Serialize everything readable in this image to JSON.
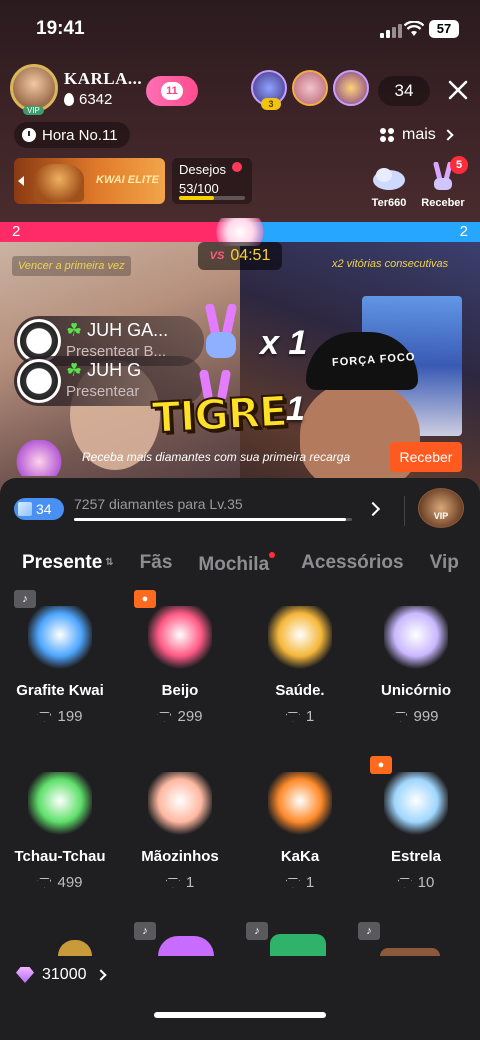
{
  "status_bar": {
    "time": "19:41",
    "battery": "57"
  },
  "host": {
    "name": "KARLA...",
    "fans": "6342",
    "vip_label": "VIP",
    "follow_count": "11"
  },
  "viewers": {
    "rank_badge": "3",
    "count": "34"
  },
  "hour": {
    "label": "Hora No.11"
  },
  "more": {
    "label": "mais"
  },
  "elite_banner": {
    "label": "KWAI ELITE"
  },
  "desejos": {
    "title": "Desejos",
    "value": "53/100",
    "progress": 0.53
  },
  "mini_gifts": [
    {
      "label": "Ter660"
    },
    {
      "label": "Receber",
      "badge": "5"
    }
  ],
  "pk": {
    "left_score": "2",
    "right_score": "2",
    "vs": "VS",
    "timer": "04:51",
    "left_label": "Vencer a primeira vez",
    "right_label": "x2 vitórias consecutivas"
  },
  "toasts": [
    {
      "name": "JUH GA...",
      "sub": "Presentear B...",
      "combo": "x 1"
    },
    {
      "name": "JUH G",
      "sub": "Presentear",
      "combo": "1"
    }
  ],
  "tigre": "TIGRE",
  "recharge": {
    "text": "Receba mais diamantes com sua primeira recarga",
    "button": "Receber"
  },
  "level": {
    "badge": "34",
    "text": "7257 diamantes para Lv.35",
    "progress": 0.98,
    "vip_label": "VIP"
  },
  "tabs": [
    "Presente",
    "Fãs",
    "Mochila",
    "Acessórios",
    "Vip"
  ],
  "gifts": [
    {
      "name": "Grafite Kwai",
      "price": "199",
      "tag": "music",
      "color": "#4fa6ff"
    },
    {
      "name": "Beijo",
      "price": "299",
      "tag": "orange",
      "color": "#ff5a86"
    },
    {
      "name": "Saúde.",
      "price": "1",
      "tag": "",
      "color": "#f5b73a"
    },
    {
      "name": "Unicórnio",
      "price": "999",
      "tag": "",
      "color": "#c9b8ff"
    },
    {
      "name": "Tchau-Tchau",
      "price": "499",
      "tag": "",
      "color": "#5fe06a"
    },
    {
      "name": "Mãozinhos",
      "price": "1",
      "tag": "",
      "color": "#ffb8a0"
    },
    {
      "name": "KaKa",
      "price": "1",
      "tag": "",
      "color": "#ff8a2a"
    },
    {
      "name": "Estrela",
      "price": "10",
      "tag": "orange",
      "color": "#9fd6ff"
    }
  ],
  "diamond_balance": "31000"
}
